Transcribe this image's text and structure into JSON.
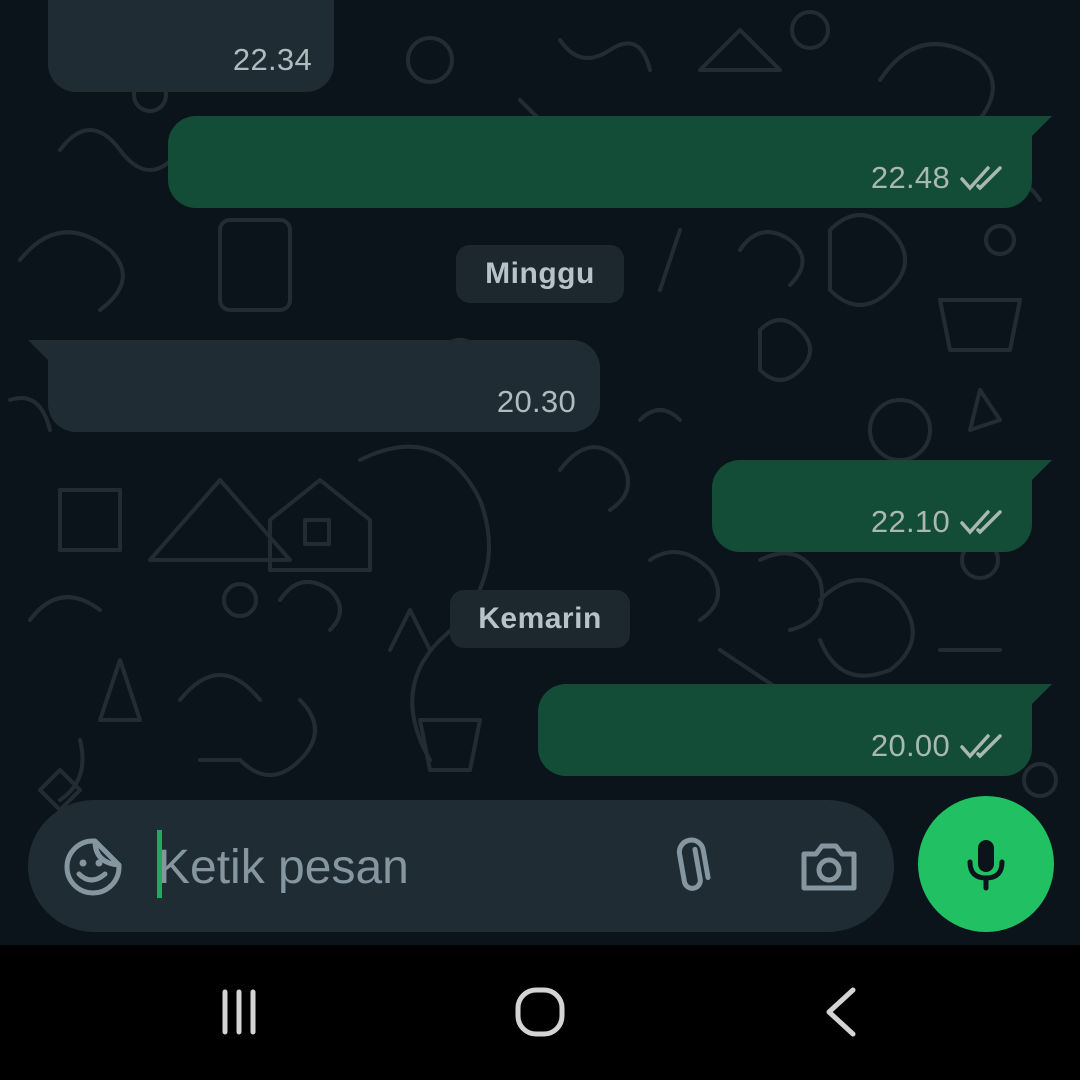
{
  "colors": {
    "background": "#0b141a",
    "incoming_bubble": "#1f2c34",
    "outgoing_bubble": "#144d37",
    "accent": "#21c063",
    "ticks": "#a9b8b2"
  },
  "messages": [
    {
      "direction": "incoming",
      "time": "22.34"
    },
    {
      "direction": "outgoing",
      "time": "22.48",
      "status_icon": "double-check-icon"
    },
    {
      "direction": "incoming",
      "time": "20.30"
    },
    {
      "direction": "outgoing",
      "time": "22.10",
      "status_icon": "double-check-icon"
    },
    {
      "direction": "outgoing",
      "time": "20.00",
      "status_icon": "double-check-icon"
    }
  ],
  "day_separators": [
    {
      "label": "Minggu"
    },
    {
      "label": "Kemarin"
    }
  ],
  "composer": {
    "placeholder": "Ketik pesan",
    "value": "",
    "emoji_icon": "sticker-icon",
    "attach_icon": "paperclip-icon",
    "camera_icon": "camera-icon",
    "mic_icon": "microphone-icon"
  },
  "system_nav": {
    "recents_icon": "recents-icon",
    "home_icon": "home-icon",
    "back_icon": "back-icon"
  }
}
